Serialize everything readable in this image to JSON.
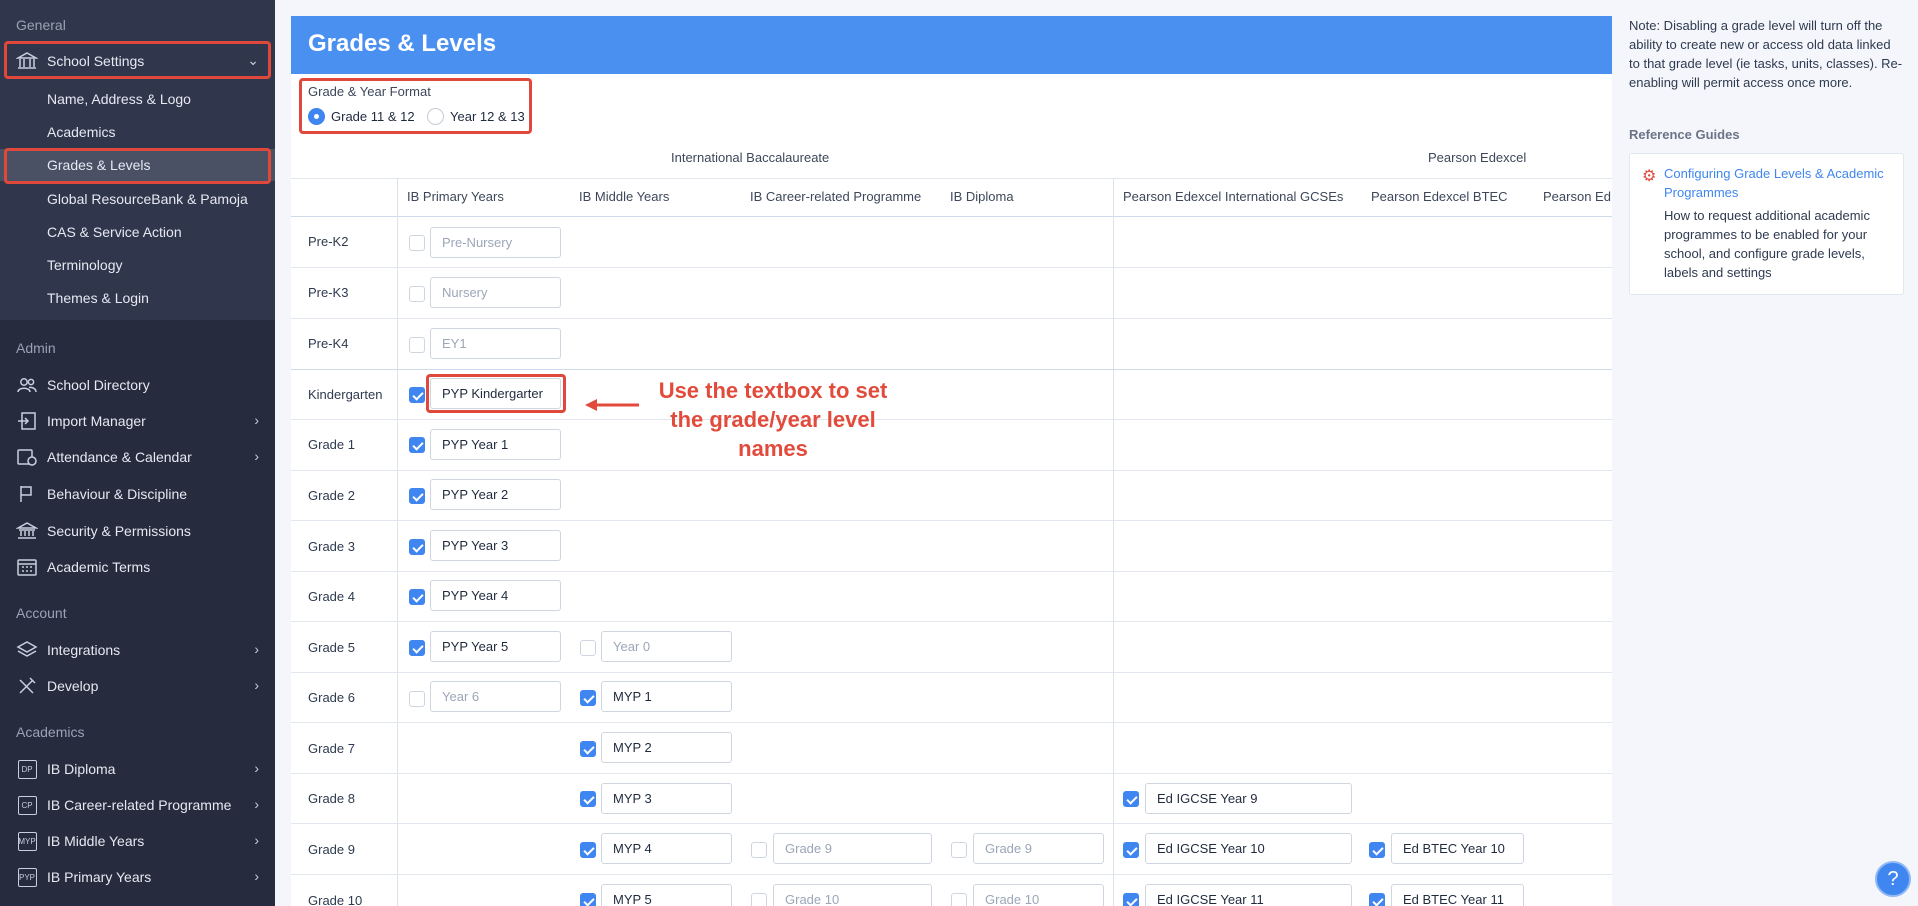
{
  "sidebar": {
    "sections": {
      "general": "General",
      "admin": "Admin",
      "account": "Account",
      "academics": "Academics"
    },
    "school_settings": "School Settings",
    "settings_sub": [
      "Name, Address & Logo",
      "Academics",
      "Grades & Levels",
      "Global ResourceBank & Pamoja",
      "CAS & Service Action",
      "Terminology",
      "Themes & Login"
    ],
    "admin_items": [
      "School Directory",
      "Import Manager",
      "Attendance & Calendar",
      "Behaviour & Discipline",
      "Security & Permissions",
      "Academic Terms"
    ],
    "account_items": [
      "Integrations",
      "Develop"
    ],
    "academic_items": [
      "IB Diploma",
      "IB Career-related Programme",
      "IB Middle Years",
      "IB Primary Years"
    ],
    "academic_badges": [
      "DP",
      "CP",
      "MYP",
      "PYP"
    ]
  },
  "main": {
    "title": "Grades & Levels",
    "format_label": "Grade & Year Format",
    "format_options": [
      "Grade 11 & 12",
      "Year 12 & 13"
    ],
    "format_selected": "Grade 11 & 12",
    "groups": [
      "International Baccalaureate",
      "Pearson Edexcel"
    ],
    "columns": [
      "IB Primary Years",
      "IB Middle Years",
      "IB Career-related Programme",
      "IB Diploma",
      "Pearson Edexcel International GCSEs",
      "Pearson Edexcel BTEC",
      "Pearson Ed"
    ],
    "rows": [
      "Pre-K2",
      "Pre-K3",
      "Pre-K4",
      "Kindergarten",
      "Grade 1",
      "Grade 2",
      "Grade 3",
      "Grade 4",
      "Grade 5",
      "Grade 6",
      "Grade 7",
      "Grade 8",
      "Grade 9",
      "Grade 10"
    ],
    "cells": {
      "pyp": [
        "Pre-Nursery",
        "Nursery",
        "EY1",
        "PYP Kindergarter",
        "PYP Year 1",
        "PYP Year 2",
        "PYP Year 3",
        "PYP Year 4",
        "PYP Year 5",
        "Year 6"
      ],
      "myp": [
        "Year 0",
        "MYP 1",
        "MYP 2",
        "MYP 3",
        "MYP 4",
        "MYP 5"
      ],
      "cp": [
        "Grade 9",
        "Grade 10"
      ],
      "dp": [
        "Grade 9",
        "Grade 10"
      ],
      "igcse": [
        "Ed IGCSE Year 9",
        "Ed IGCSE Year 10",
        "Ed IGCSE Year 11"
      ],
      "btec": [
        "Ed BTEC Year 10",
        "Ed BTEC Year 11"
      ]
    },
    "annotation": "Use the textbox to set the grade/year level names"
  },
  "right_panel": {
    "note": "Note: Disabling a grade level will turn off the ability to create new or access old data linked to that grade level (ie tasks, units, classes). Re-enabling will permit access once more.",
    "ref_heading": "Reference Guides",
    "ref_link": "Configuring Grade Levels & Academic Programmes",
    "ref_desc": "How to request additional academic programmes to be enabled for your school, and configure grade levels, labels and settings"
  },
  "help_label": "?"
}
